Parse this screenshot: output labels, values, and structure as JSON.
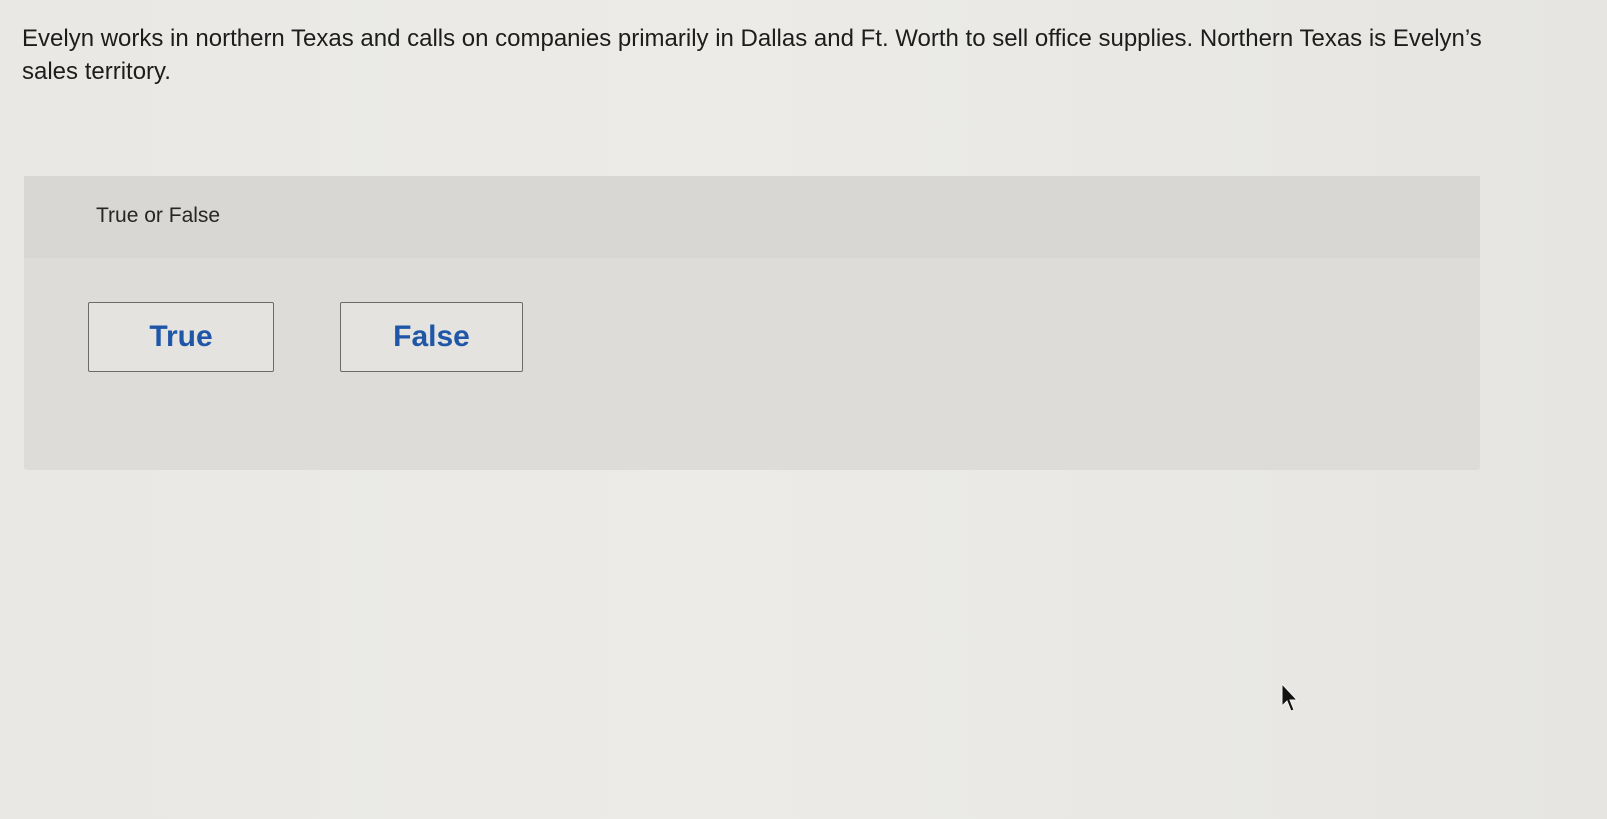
{
  "question": {
    "text": "Evelyn works in northern Texas and calls on companies primarily in Dallas and Ft. Worth to sell office supplies. Northern Texas is Evelyn’s sales territory."
  },
  "answer_panel": {
    "title": "True or False",
    "choices": [
      {
        "label": "True"
      },
      {
        "label": "False"
      }
    ]
  },
  "colors": {
    "choice_text": "#2056a8",
    "panel_background": "#dddcd8",
    "page_background": "#ebeae6"
  },
  "icons": {
    "cursor": "mouse-pointer-icon"
  }
}
